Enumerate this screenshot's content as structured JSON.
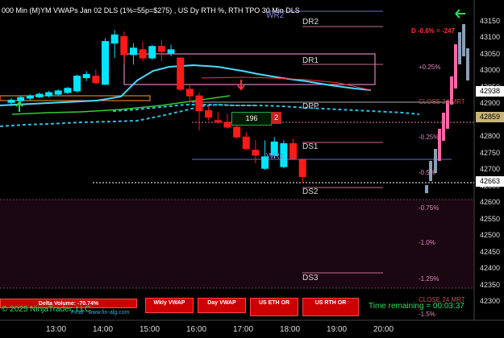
{
  "header": {
    "title": "000 Min (M)YM VWAPs Jan 02 DLS (1%=55p=$275) , US Dy RTH %, RTH TPO 30 Min DLS",
    "delta_percent": "D -0.6%  = -247",
    "back_arrow": "arrow-left-icon"
  },
  "price_axis": [
    "43150",
    "43100",
    "43050",
    "43000",
    "42950",
    "42900",
    "42850",
    "42800",
    "42750",
    "42700",
    "42650",
    "42600",
    "42550",
    "42500",
    "42450",
    "42400",
    "42350",
    "42300"
  ],
  "price_markers": [
    {
      "label": "42938",
      "bg": "#ffffff",
      "fg": "#000000"
    },
    {
      "label": "42859",
      "bg": "#c8b478",
      "fg": "#000000"
    },
    {
      "label": "42663",
      "bg": "#ffffff",
      "fg": "#000000"
    }
  ],
  "time_axis": [
    "13:00",
    "14:00",
    "15:00",
    "16:00",
    "17:00",
    "18:00",
    "19:00",
    "20:00"
  ],
  "pivots": {
    "dr2": "DR2",
    "dr1": "DR1",
    "dpp": "DPP",
    "ds1": "DS1",
    "ds2": "DS2",
    "ds3": "DS3",
    "wr2": "WR2",
    "wr1": "WR1"
  },
  "percent_levels": {
    "p025": "+0.25%",
    "m025": "-0.25%",
    "m05": "-0.5%",
    "m075": "-0.75%",
    "m10": "-1.0%",
    "m125": "-1.25%",
    "m15": "-1.5%",
    "close_top": "CLOSE 24 MRT",
    "close_bottom": "CLOSE 24 MRT"
  },
  "order_box": {
    "qty": "196",
    "count": "2"
  },
  "buttons": {
    "delta_volume": "Delta Volume: -70.74%",
    "wkly_vwap": "Wkly VWAP",
    "day_vwap": "Day VWAP",
    "us_eth_or": "US ETH OR",
    "us_rth_or": "US RTH OR"
  },
  "footer": {
    "copyright": "© 2025 NinjaTrader, LLC",
    "final": "Final - www.fin-alg.com",
    "time_remaining": "Time remaining = 00:03:37"
  },
  "colors": {
    "up_candle": "#00e5ff",
    "down_candle": "#ff1a1a",
    "vwap": "#4dd9ff",
    "green_line": "#33cc33",
    "pink": "#e08ac0",
    "bg": "#000000"
  },
  "candles": [
    {
      "o": 42905,
      "h": 42918,
      "l": 42893,
      "c": 42912
    },
    {
      "o": 42910,
      "h": 42925,
      "l": 42905,
      "c": 42920
    },
    {
      "o": 42918,
      "h": 42930,
      "l": 42912,
      "c": 42925
    },
    {
      "o": 42922,
      "h": 42935,
      "l": 42918,
      "c": 42930
    },
    {
      "o": 42925,
      "h": 42940,
      "l": 42920,
      "c": 42935
    },
    {
      "o": 42930,
      "h": 42945,
      "l": 42925,
      "c": 42940
    },
    {
      "o": 42935,
      "h": 42952,
      "l": 42930,
      "c": 42948
    },
    {
      "o": 42940,
      "h": 42990,
      "l": 42935,
      "c": 42985
    },
    {
      "o": 42980,
      "h": 43000,
      "l": 42970,
      "c": 42990
    },
    {
      "o": 42985,
      "h": 43005,
      "l": 42960,
      "c": 42965
    },
    {
      "o": 42960,
      "h": 43100,
      "l": 42958,
      "c": 43090
    },
    {
      "o": 43085,
      "h": 43125,
      "l": 43040,
      "c": 43110
    },
    {
      "o": 43105,
      "h": 43120,
      "l": 43020,
      "c": 43050
    },
    {
      "o": 43050,
      "h": 43085,
      "l": 43020,
      "c": 43070
    },
    {
      "o": 43065,
      "h": 43090,
      "l": 43030,
      "c": 43040
    },
    {
      "o": 43040,
      "h": 43080,
      "l": 43035,
      "c": 43075
    },
    {
      "o": 43075,
      "h": 43095,
      "l": 43030,
      "c": 43060
    },
    {
      "o": 43055,
      "h": 43080,
      "l": 43045,
      "c": 43065
    },
    {
      "o": 43040,
      "h": 43042,
      "l": 42940,
      "c": 42945
    },
    {
      "o": 42945,
      "h": 42960,
      "l": 42900,
      "c": 42925
    },
    {
      "o": 42925,
      "h": 42935,
      "l": 42820,
      "c": 42880
    },
    {
      "o": 42880,
      "h": 42895,
      "l": 42850,
      "c": 42860
    },
    {
      "o": 42850,
      "h": 42875,
      "l": 42840,
      "c": 42845
    },
    {
      "o": 42845,
      "h": 42870,
      "l": 42825,
      "c": 42830
    },
    {
      "o": 42830,
      "h": 42840,
      "l": 42795,
      "c": 42800
    },
    {
      "o": 42800,
      "h": 42815,
      "l": 42760,
      "c": 42765
    },
    {
      "o": 42760,
      "h": 42790,
      "l": 42720,
      "c": 42745
    },
    {
      "o": 42705,
      "h": 42790,
      "l": 42700,
      "c": 42740
    },
    {
      "o": 42745,
      "h": 42800,
      "l": 42735,
      "c": 42785
    },
    {
      "o": 42710,
      "h": 42790,
      "l": 42705,
      "c": 42780
    },
    {
      "o": 42780,
      "h": 42795,
      "l": 42730,
      "c": 42735
    },
    {
      "o": 42730,
      "h": 42735,
      "l": 42660,
      "c": 42680
    }
  ]
}
